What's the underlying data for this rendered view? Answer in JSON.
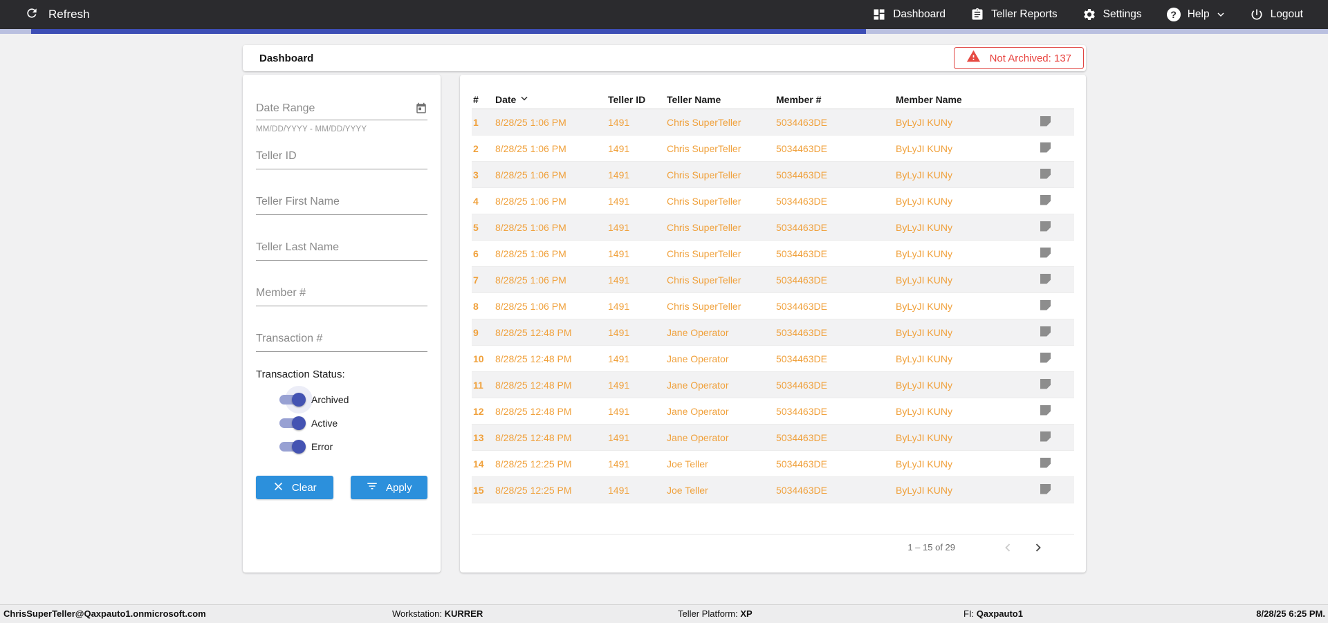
{
  "navbar": {
    "refresh_label": "Refresh",
    "items": [
      {
        "label": "Dashboard"
      },
      {
        "label": "Teller Reports"
      },
      {
        "label": "Settings"
      },
      {
        "label": "Help"
      },
      {
        "label": "Logout"
      }
    ],
    "help_glyph": "?"
  },
  "header": {
    "title": "Dashboard",
    "alert_label": "Not Archived: 137"
  },
  "filters": {
    "date_range": {
      "label": "Date Range",
      "helper": "MM/DD/YYYY - MM/DD/YYYY"
    },
    "fields": [
      {
        "label": "Teller ID"
      },
      {
        "label": "Teller First Name"
      },
      {
        "label": "Teller Last Name"
      },
      {
        "label": "Member #"
      },
      {
        "label": "Transaction #"
      }
    ],
    "status_label": "Transaction Status:",
    "toggles": [
      {
        "label": "Archived",
        "state": "on"
      },
      {
        "label": "Active",
        "state": "on"
      },
      {
        "label": "Error",
        "state": "on"
      }
    ],
    "clear_label": "Clear",
    "apply_label": "Apply"
  },
  "table": {
    "columns": [
      "#",
      "Date",
      "Teller ID",
      "Teller Name",
      "Member #",
      "Member Name"
    ],
    "sorted_column": "Date",
    "rows": [
      {
        "num": "1",
        "date": "8/28/25 1:06 PM",
        "teller_id": "1491",
        "teller_name": "Chris SuperTeller",
        "member_num": "5034463DE",
        "member_name": "ByLyJI KUNy"
      },
      {
        "num": "2",
        "date": "8/28/25 1:06 PM",
        "teller_id": "1491",
        "teller_name": "Chris SuperTeller",
        "member_num": "5034463DE",
        "member_name": "ByLyJI KUNy"
      },
      {
        "num": "3",
        "date": "8/28/25 1:06 PM",
        "teller_id": "1491",
        "teller_name": "Chris SuperTeller",
        "member_num": "5034463DE",
        "member_name": "ByLyJI KUNy"
      },
      {
        "num": "4",
        "date": "8/28/25 1:06 PM",
        "teller_id": "1491",
        "teller_name": "Chris SuperTeller",
        "member_num": "5034463DE",
        "member_name": "ByLyJI KUNy"
      },
      {
        "num": "5",
        "date": "8/28/25 1:06 PM",
        "teller_id": "1491",
        "teller_name": "Chris SuperTeller",
        "member_num": "5034463DE",
        "member_name": "ByLyJI KUNy"
      },
      {
        "num": "6",
        "date": "8/28/25 1:06 PM",
        "teller_id": "1491",
        "teller_name": "Chris SuperTeller",
        "member_num": "5034463DE",
        "member_name": "ByLyJI KUNy"
      },
      {
        "num": "7",
        "date": "8/28/25 1:06 PM",
        "teller_id": "1491",
        "teller_name": "Chris SuperTeller",
        "member_num": "5034463DE",
        "member_name": "ByLyJI KUNy"
      },
      {
        "num": "8",
        "date": "8/28/25 1:06 PM",
        "teller_id": "1491",
        "teller_name": "Chris SuperTeller",
        "member_num": "5034463DE",
        "member_name": "ByLyJI KUNy"
      },
      {
        "num": "9",
        "date": "8/28/25 12:48 PM",
        "teller_id": "1491",
        "teller_name": "Jane Operator",
        "member_num": "5034463DE",
        "member_name": "ByLyJI KUNy"
      },
      {
        "num": "10",
        "date": "8/28/25 12:48 PM",
        "teller_id": "1491",
        "teller_name": "Jane Operator",
        "member_num": "5034463DE",
        "member_name": "ByLyJI KUNy"
      },
      {
        "num": "11",
        "date": "8/28/25 12:48 PM",
        "teller_id": "1491",
        "teller_name": "Jane Operator",
        "member_num": "5034463DE",
        "member_name": "ByLyJI KUNy"
      },
      {
        "num": "12",
        "date": "8/28/25 12:48 PM",
        "teller_id": "1491",
        "teller_name": "Jane Operator",
        "member_num": "5034463DE",
        "member_name": "ByLyJI KUNy"
      },
      {
        "num": "13",
        "date": "8/28/25 12:48 PM",
        "teller_id": "1491",
        "teller_name": "Jane Operator",
        "member_num": "5034463DE",
        "member_name": "ByLyJI KUNy"
      },
      {
        "num": "14",
        "date": "8/28/25 12:25 PM",
        "teller_id": "1491",
        "teller_name": "Joe Teller",
        "member_num": "5034463DE",
        "member_name": "ByLyJI KUNy"
      },
      {
        "num": "15",
        "date": "8/28/25 12:25 PM",
        "teller_id": "1491",
        "teller_name": "Joe Teller",
        "member_num": "5034463DE",
        "member_name": "ByLyJI KUNy"
      }
    ],
    "pagination": {
      "range_label": "1 – 15 of 29"
    }
  },
  "footer": {
    "items": [
      {
        "label": "",
        "value": "ChrisSuperTeller@Qaxpauto1.onmicrosoft.com"
      },
      {
        "label": "Workstation: ",
        "value": "KURRER"
      },
      {
        "label": "Teller Platform: ",
        "value": "XP"
      },
      {
        "label": "FI: ",
        "value": "Qaxpauto1"
      },
      {
        "label": "",
        "value": "8/28/25 6:25 PM."
      }
    ]
  },
  "colors": {
    "navbar_bg": "#2b2b2e",
    "progress_fill": "#3d4eb5",
    "progress_track": "#bac0e0",
    "accent_button_blue": "#2c90dc",
    "toggle_indigo": "#4453b2",
    "data_orange": "#f0a13c",
    "alert_red": "#e8423e",
    "row_stripe": "#f2f2f3"
  }
}
